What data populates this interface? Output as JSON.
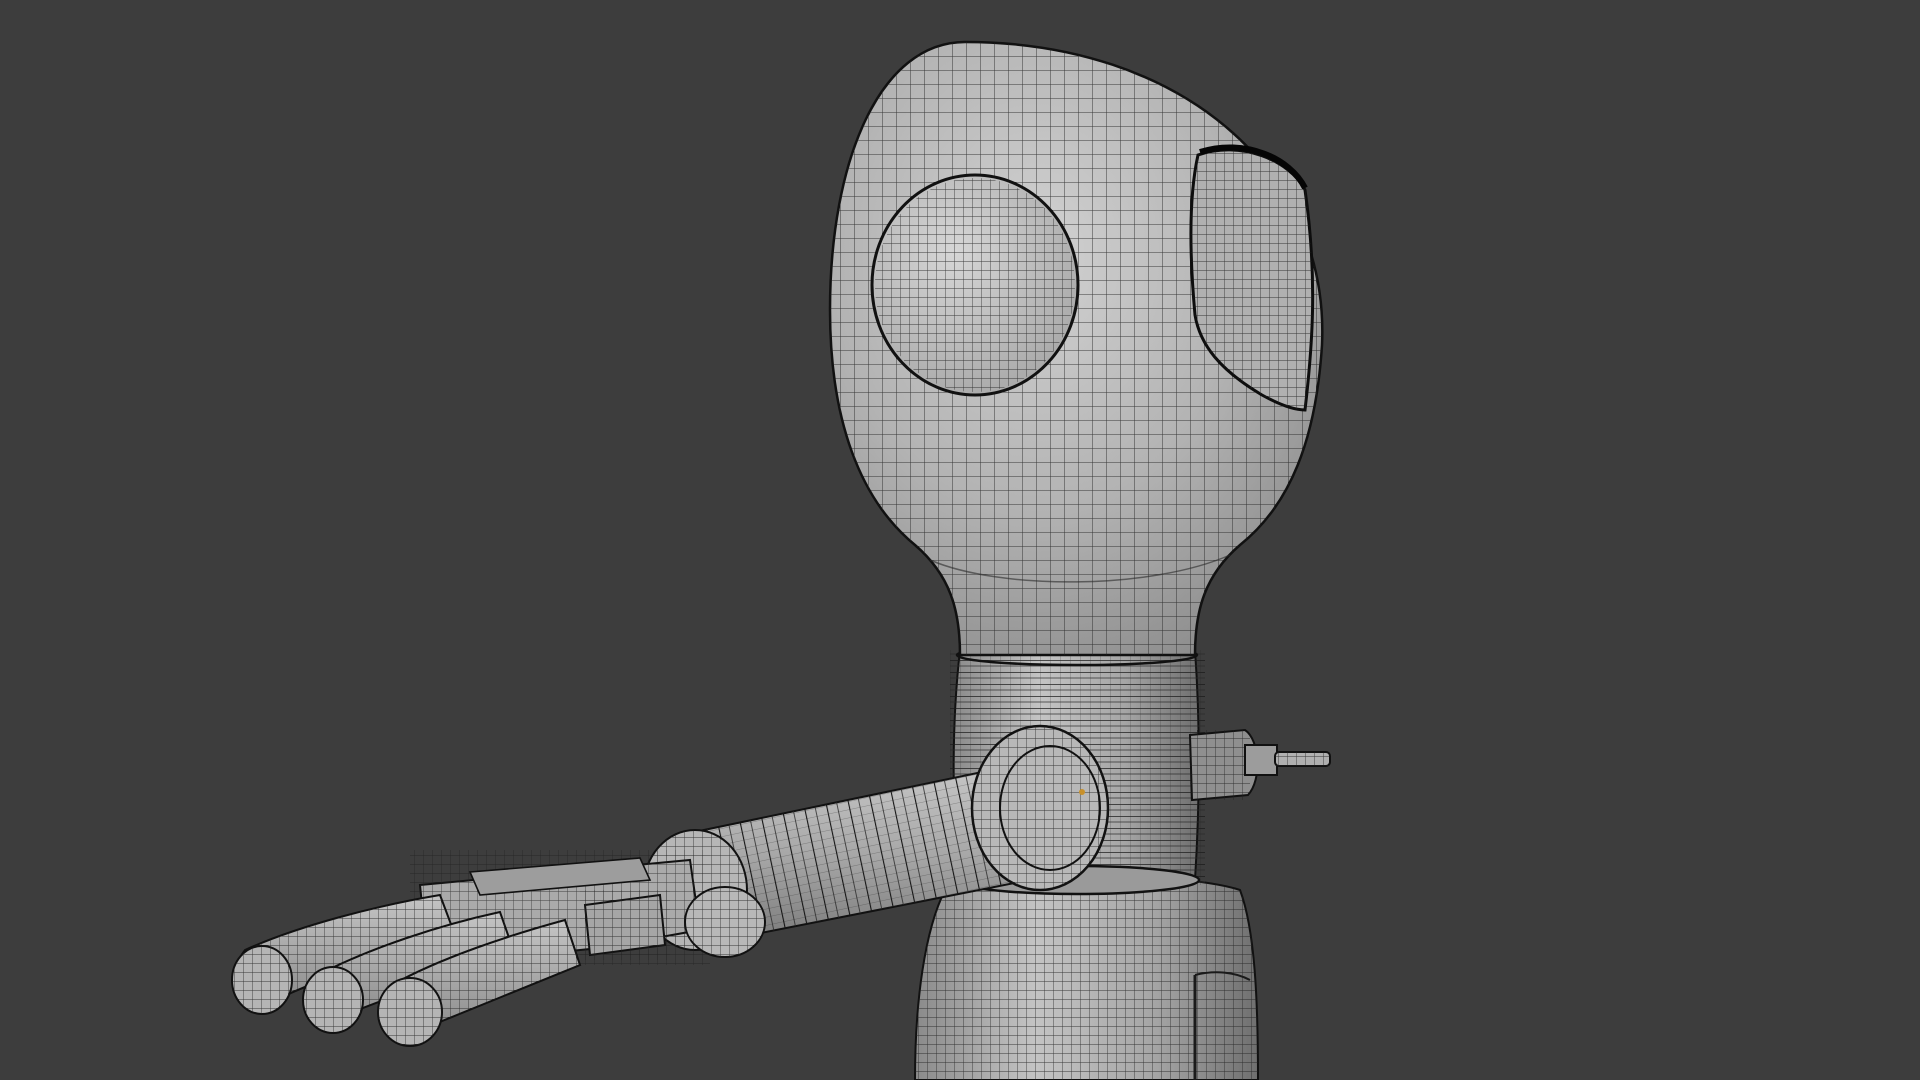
{
  "viewport": {
    "background": "#3d3d3d",
    "shading": "solid-wireframe"
  },
  "model": {
    "base_color": "#a8a8a8",
    "light_color": "#cfcfcf",
    "dark_color": "#5a5a5a",
    "wire_color": "#1e1e1e",
    "parts": [
      "head",
      "eye-left",
      "eye-right-visor",
      "neck-bellows",
      "shoulder-joint",
      "upper-arm-bellows",
      "wrist-knob",
      "hand-palm",
      "finger-1",
      "finger-2",
      "finger-3",
      "thumb",
      "torso",
      "back-connector"
    ]
  }
}
